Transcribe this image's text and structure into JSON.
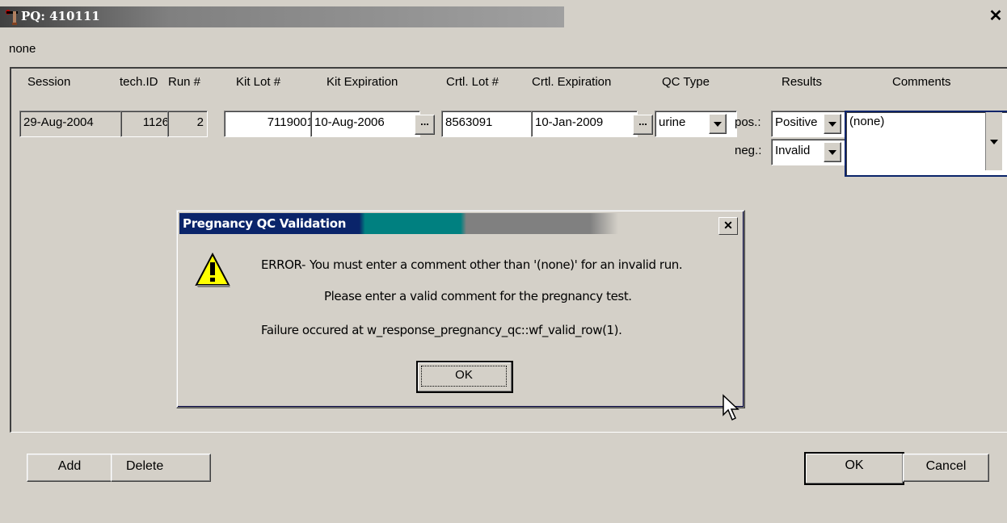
{
  "window": {
    "title": "PQ: 410111",
    "subtitle": "none"
  },
  "columns": [
    "Session",
    "tech.ID",
    "Run #",
    "Kit Lot #",
    "Kit Expiration",
    "Crtl. Lot #",
    "Crtl. Expiration",
    "QC Type",
    "Results",
    "Comments"
  ],
  "row": {
    "session": "29-Aug-2004",
    "tech_id": "1126",
    "run": "2",
    "kit_lot": "7119001",
    "kit_expiration": "10-Aug-2006",
    "ctrl_lot": "8563091",
    "ctrl_expiration": "10-Jan-2009",
    "qc_type": "urine",
    "pos_label": "pos.:",
    "pos_value": "Positive",
    "neg_label": "neg.:",
    "neg_value": "Invalid",
    "comment": "(none)"
  },
  "buttons": {
    "add": "Add",
    "delete": "Delete",
    "ok": "OK",
    "cancel": "Cancel",
    "ellipsis": "..."
  },
  "dialog": {
    "title": "Pregnancy QC Validation",
    "error_label": "ERROR-",
    "line1": "You must enter a comment other than '(none)' for an invalid run.",
    "line2": "Please enter a valid comment for the pregnancy test.",
    "line3": "Failure occured at w_response_pregnancy_qc::wf_valid_row(1).",
    "ok": "OK",
    "close": "✕"
  },
  "icons": {
    "warning": "warning-icon",
    "close": "close-icon",
    "app": "app-icon",
    "cursor": "mouse-cursor-icon"
  }
}
